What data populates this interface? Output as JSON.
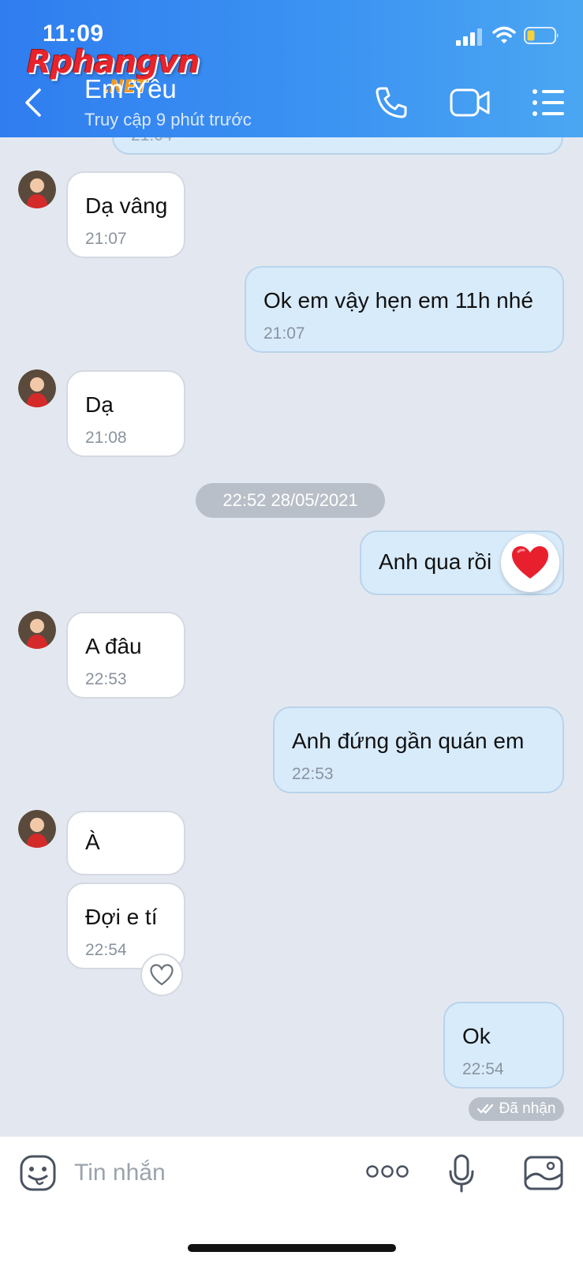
{
  "status_bar": {
    "time": "11:09"
  },
  "watermark": {
    "main": "Rphangvn",
    "suffix": ".NET"
  },
  "header": {
    "contact_name": "Em Yêu",
    "contact_status": "Truy cập 9 phút trước",
    "accent_color": "#3a8ef2"
  },
  "chat": {
    "partial_time": "21:04",
    "messages": [
      {
        "side": "in",
        "text": "Dạ vâng",
        "time": "21:07"
      },
      {
        "side": "out",
        "text": "Ok em vậy hẹn em 11h nhé",
        "time": "21:07"
      },
      {
        "side": "in",
        "text": "Dạ",
        "time": "21:08"
      },
      {
        "side": "out",
        "text": "Anh qua rồi",
        "time": "",
        "reaction": "heart"
      },
      {
        "side": "in",
        "text": "A đâu",
        "time": "22:53"
      },
      {
        "side": "out",
        "text": "Anh đứng gần quán em",
        "time": "22:53"
      },
      {
        "side": "in",
        "text": "À",
        "time": ""
      },
      {
        "side": "in",
        "text": "Đợi e tí",
        "time": "22:54"
      },
      {
        "side": "out",
        "text": "Ok",
        "time": "22:54"
      }
    ],
    "date_separator": "22:52 28/05/2021",
    "receipt": "Đã nhận",
    "bubble_in_color": "#ffffff",
    "bubble_out_color": "#d8ebfb"
  },
  "composer": {
    "placeholder": "Tin nhắn"
  }
}
